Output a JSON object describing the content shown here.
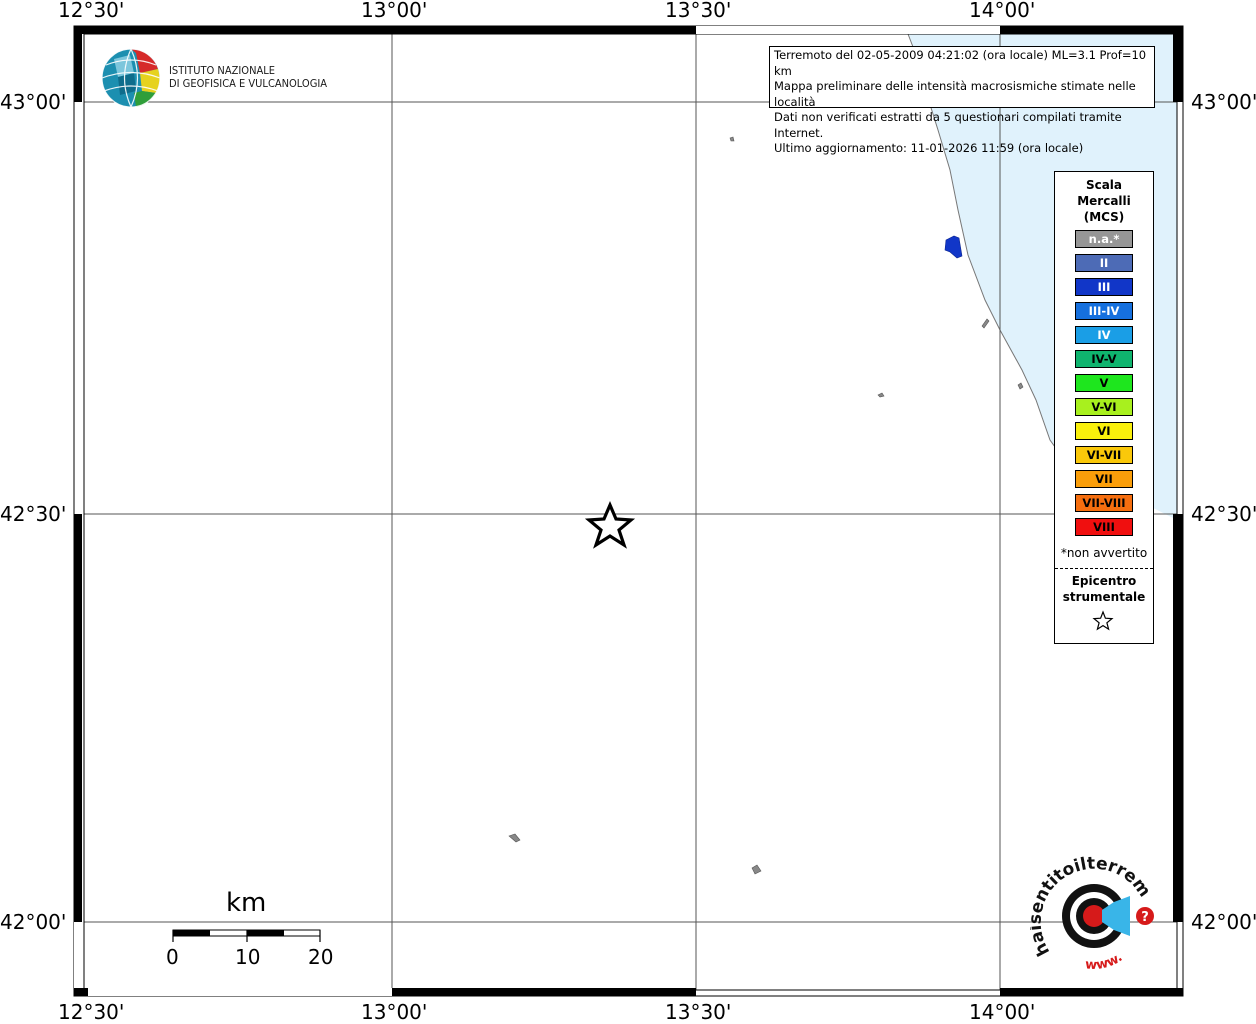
{
  "map": {
    "top_lon_labels": [
      "12°30'",
      "13°00'",
      "13°30'",
      "14°00'"
    ],
    "bottom_lon_labels": [
      "12°30'",
      "13°00'",
      "13°30'",
      "14°00'"
    ],
    "left_lat_labels": [
      "43°00'",
      "42°30'",
      "42°00'"
    ],
    "right_lat_labels": [
      "43°00'",
      "42°30'",
      "42°00'"
    ],
    "sea_color": "#e0f2fc",
    "intensity_site_color": "#1136c8"
  },
  "institute": {
    "line1": "ISTITUTO NAZIONALE",
    "line2": "DI GEOFISICA E VULCANOLOGIA",
    "logo_icon": "ingv-globe-logo"
  },
  "info": {
    "line1": "Terremoto del 02-05-2009 04:21:02 (ora locale) ML=3.1 Prof=10 km",
    "line2": "Mappa preliminare delle intensità macrosismiche stimate nelle località",
    "line3": "Dati non verificati estratti da 5 questionari compilati tramite Internet.",
    "line4": "Ultimo aggiornamento: 11-01-2026 11:59 (ora locale)"
  },
  "legend": {
    "title1": "Scala",
    "title2": "Mercalli",
    "title3": "(MCS)",
    "items": [
      {
        "label": "n.a.*",
        "color": "#969696"
      },
      {
        "label": "II",
        "color": "#4d6bb6"
      },
      {
        "label": "III",
        "color": "#1136c8"
      },
      {
        "label": "III-IV",
        "color": "#1670de"
      },
      {
        "label": "IV",
        "color": "#1a9ee6"
      },
      {
        "label": "IV-V",
        "color": "#0fb46e"
      },
      {
        "label": "V",
        "color": "#1ee61e"
      },
      {
        "label": "V-VI",
        "color": "#a8f01e"
      },
      {
        "label": "VI",
        "color": "#faf00c"
      },
      {
        "label": "VI-VII",
        "color": "#fac80a"
      },
      {
        "label": "VII",
        "color": "#fa9e0a"
      },
      {
        "label": "VII-VIII",
        "color": "#f56e0f"
      },
      {
        "label": "VIII",
        "color": "#f00f0f"
      }
    ],
    "note": "*non avvertito",
    "epicentre1": "Epicentro",
    "epicentre2": "strumentale",
    "epicentre_icon": "star-outline-icon"
  },
  "scalebar": {
    "unit": "km",
    "labels": [
      "0",
      "10",
      "20"
    ]
  },
  "haisentito_logo": {
    "text": "haisentitoilterremoto.it",
    "www": "www.",
    "icon": "loudspeaker-target-logo"
  }
}
